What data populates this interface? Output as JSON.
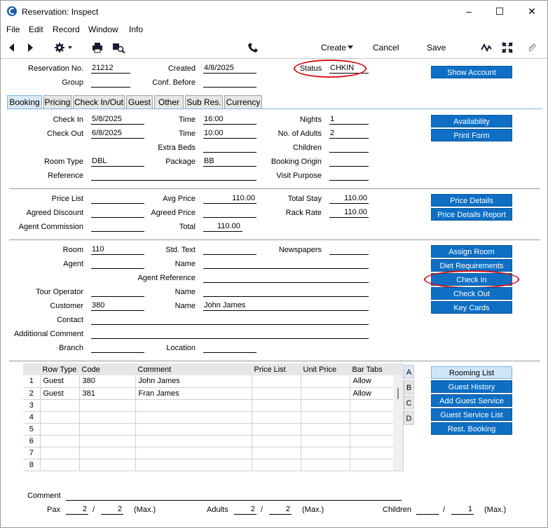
{
  "window": {
    "title": "Reservation: Inspect"
  },
  "menu": [
    "File",
    "Edit",
    "Record",
    "Window",
    "Info"
  ],
  "toolbar": {
    "create": "Create",
    "cancel": "Cancel",
    "save": "Save"
  },
  "header": {
    "reservation_no_label": "Reservation No.",
    "reservation_no": "21212",
    "created_label": "Created",
    "created": "4/8/2025",
    "status_label": "Status",
    "status": "CHKIN",
    "group_label": "Group",
    "group": "",
    "conf_before_label": "Conf. Before",
    "conf_before": "",
    "show_account": "Show Account"
  },
  "tabs": [
    "Booking",
    "Pricing",
    "Check In/Out",
    "Guest",
    "Other",
    "Sub Res.",
    "Currency"
  ],
  "booking": {
    "check_in_label": "Check In",
    "check_in": "5/8/2025",
    "time_label": "Time",
    "time_in": "16:00",
    "nights_label": "Nights",
    "nights": "1",
    "check_out_label": "Check Out",
    "check_out": "6/8/2025",
    "time_out": "10:00",
    "adults_label": "No. of Adults",
    "adults": "2",
    "extra_beds_label": "Extra Beds",
    "extra_beds": "",
    "children_label": "Children",
    "children": "",
    "room_type_label": "Room Type",
    "room_type": "DBL",
    "package_label": "Package",
    "package": "BB",
    "booking_origin_label": "Booking Origin",
    "booking_origin": "",
    "reference_label": "Reference",
    "reference": "",
    "visit_purpose_label": "Visit Purpose",
    "visit_purpose": "",
    "availability": "Availability",
    "print_form": "Print Form"
  },
  "pricing": {
    "price_list_label": "Price List",
    "price_list": "",
    "avg_price_label": "Avg Price",
    "avg_price": "110.00",
    "total_stay_label": "Total Stay",
    "total_stay": "110.00",
    "agreed_discount_label": "Agreed Discount",
    "agreed_discount": "",
    "agreed_price_label": "Agreed Price",
    "agreed_price": "",
    "rack_rate_label": "Rack Rate",
    "rack_rate": "110.00",
    "agent_commission_label": "Agent Commission",
    "agent_commission": "",
    "total_label": "Total",
    "total": "110.00",
    "price_details": "Price Details",
    "price_details_report": "Price Details Report"
  },
  "guest": {
    "room_label": "Room",
    "room": "110",
    "std_text_label": "Std. Text",
    "std_text": "",
    "newspapers_label": "Newspapers",
    "newspapers": "",
    "agent_label": "Agent",
    "agent": "",
    "name_label": "Name",
    "agent_name": "",
    "agent_reference_label": "Agent Reference",
    "agent_reference": "",
    "tour_operator_label": "Tour Operator",
    "tour_operator": "",
    "tour_name": "",
    "customer_label": "Customer",
    "customer": "380",
    "customer_name": "John James",
    "contact_label": "Contact",
    "contact": "",
    "additional_comment_label": "Additional Comment",
    "additional_comment": "",
    "branch_label": "Branch",
    "branch": "",
    "location_label": "Location",
    "location": "",
    "assign_room": "Assign Room",
    "diet_requirements": "Diet Requirements",
    "check_in": "Check In",
    "check_out": "Check Out",
    "key_cards": "Key Cards"
  },
  "rows_table": {
    "columns": [
      "Row Type",
      "Code",
      "Comment",
      "Price List",
      "Unit Price",
      "Bar Tabs"
    ],
    "rows": [
      {
        "n": "1",
        "type": "Guest",
        "code": "380",
        "comment": "John James",
        "price_list": "",
        "unit_price": "",
        "bar_tabs": "Allow"
      },
      {
        "n": "2",
        "type": "Guest",
        "code": "381",
        "comment": "Fran James",
        "price_list": "",
        "unit_price": "",
        "bar_tabs": "Allow"
      },
      {
        "n": "3",
        "type": "",
        "code": "",
        "comment": "",
        "price_list": "",
        "unit_price": "",
        "bar_tabs": ""
      },
      {
        "n": "4",
        "type": "",
        "code": "",
        "comment": "",
        "price_list": "",
        "unit_price": "",
        "bar_tabs": ""
      },
      {
        "n": "5",
        "type": "",
        "code": "",
        "comment": "",
        "price_list": "",
        "unit_price": "",
        "bar_tabs": ""
      },
      {
        "n": "6",
        "type": "",
        "code": "",
        "comment": "",
        "price_list": "",
        "unit_price": "",
        "bar_tabs": ""
      },
      {
        "n": "7",
        "type": "",
        "code": "",
        "comment": "",
        "price_list": "",
        "unit_price": "",
        "bar_tabs": ""
      },
      {
        "n": "8",
        "type": "",
        "code": "",
        "comment": "",
        "price_list": "",
        "unit_price": "",
        "bar_tabs": ""
      }
    ],
    "side_tabs": [
      "A",
      "B",
      "C",
      "D"
    ]
  },
  "row_buttons": [
    "Rooming List",
    "Guest History",
    "Add Guest Service",
    "Guest Service List",
    "Rest. Booking"
  ],
  "footer": {
    "comment_label": "Comment",
    "comment": "",
    "pax_label": "Pax",
    "pax": "2",
    "pax_max": "2",
    "adults_label": "Adults",
    "adults": "2",
    "adults_max": "2",
    "children_label": "Children",
    "children": "",
    "children_max": "1",
    "slash": "/",
    "max_label": "(Max.)"
  },
  "colors": {
    "button": "#0e6fc4",
    "highlight": "#d8141b"
  }
}
